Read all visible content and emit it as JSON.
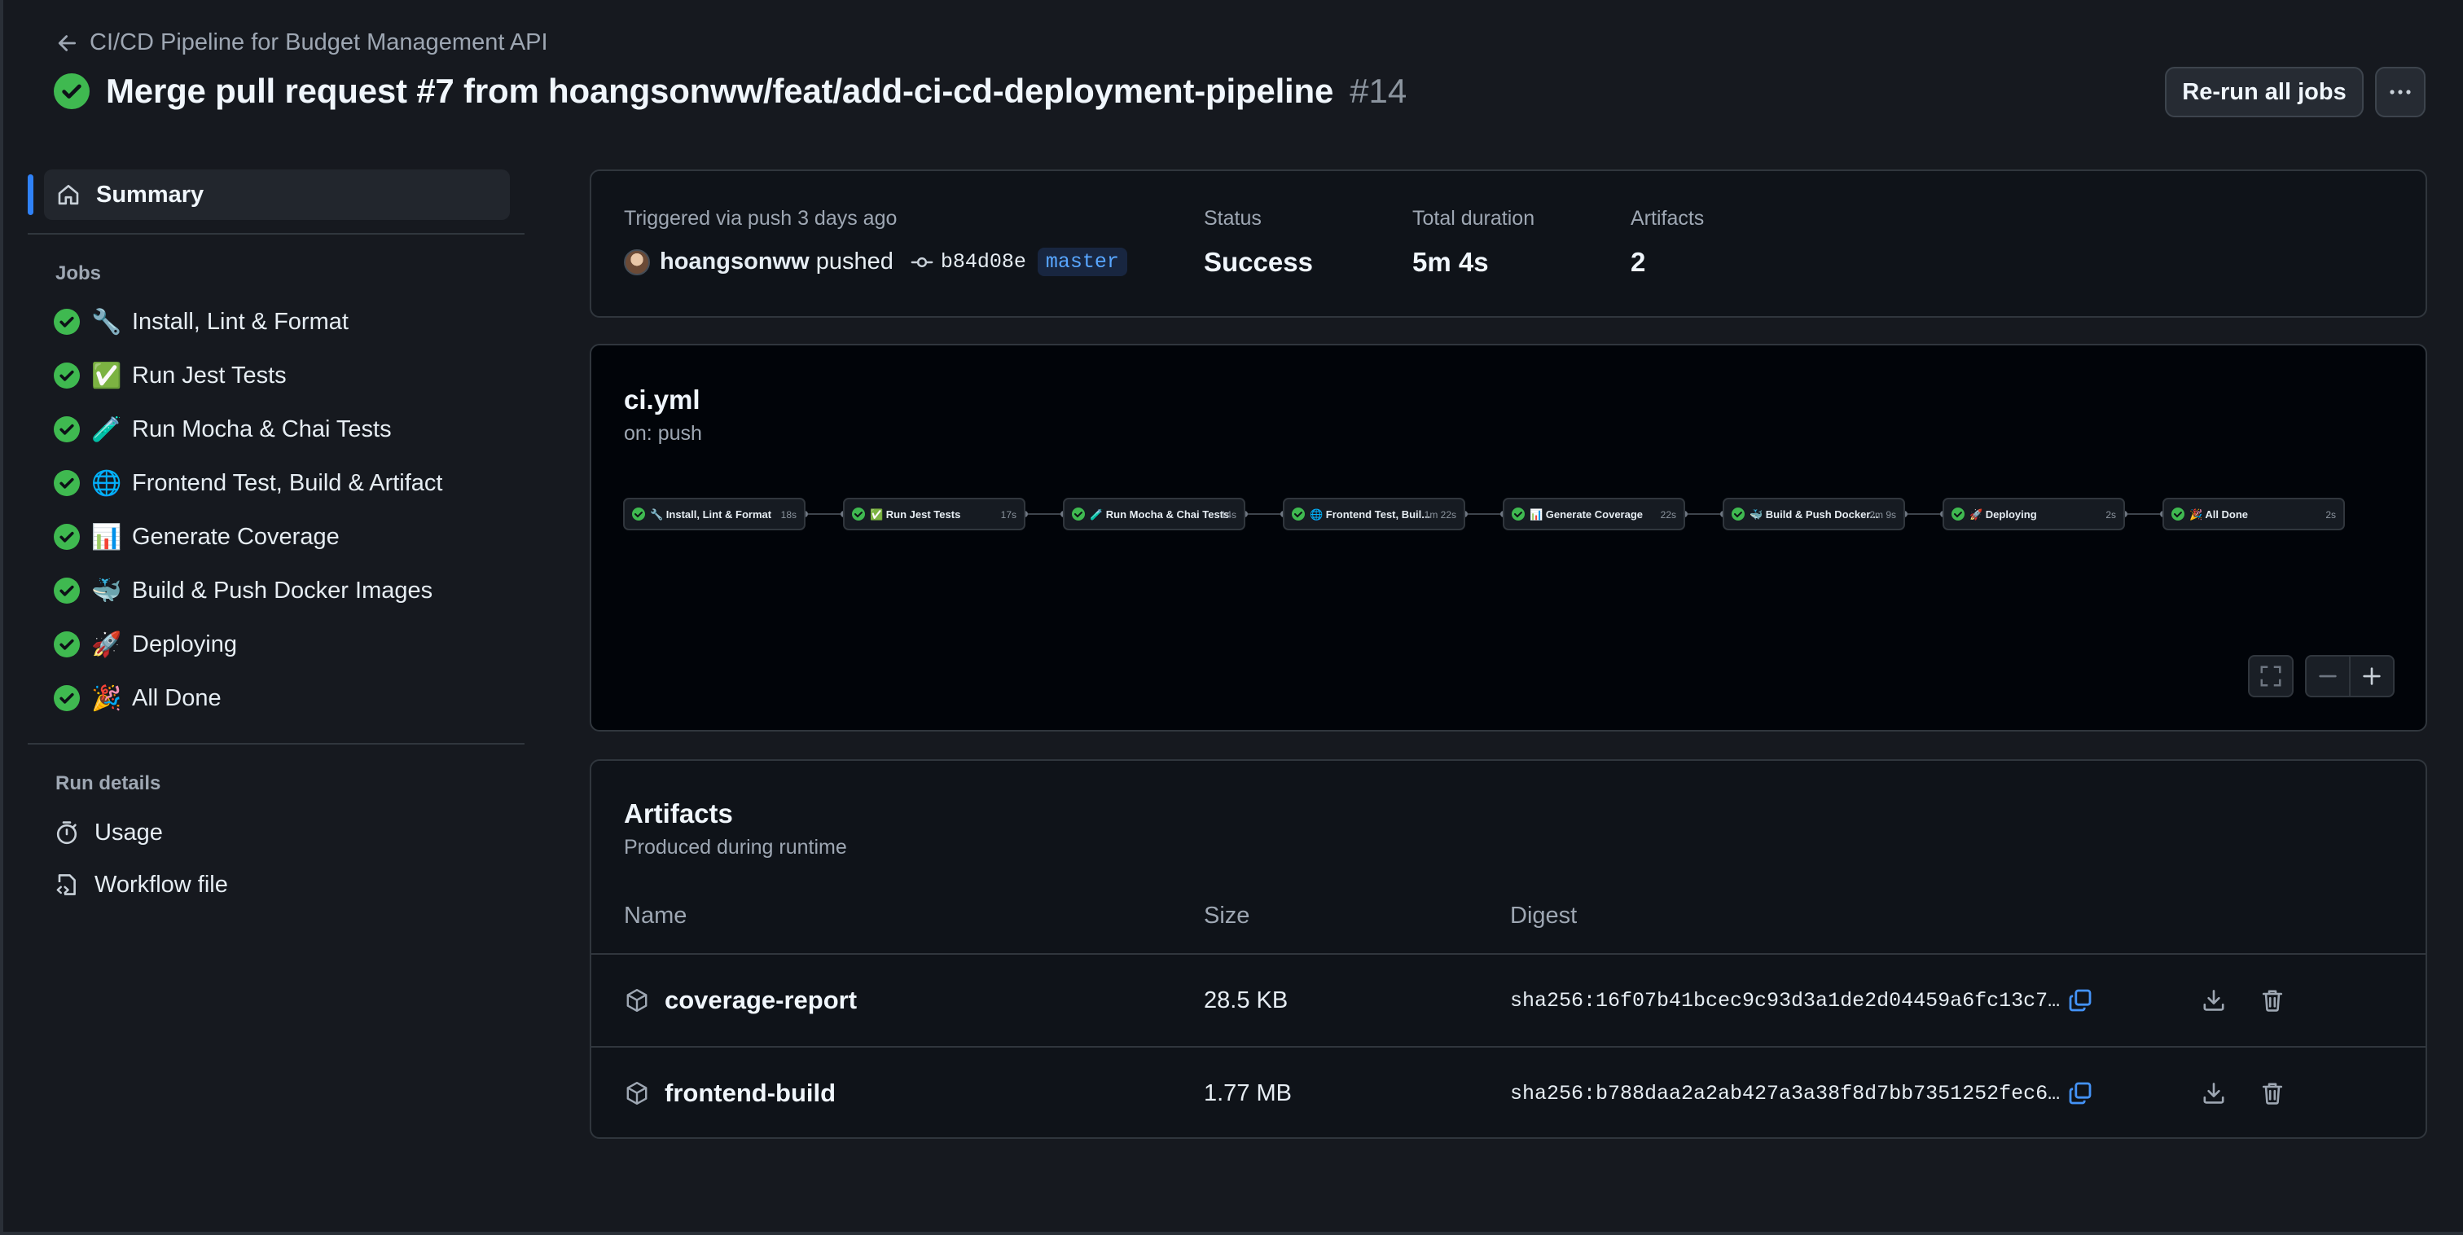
{
  "header": {
    "back_label": "CI/CD Pipeline for Budget Management API",
    "title": "Merge pull request #7 from hoangsonww/feat/add-ci-cd-deployment-pipeline",
    "run_number": "#14",
    "rerun_label": "Re-run all jobs"
  },
  "sidebar": {
    "summary_label": "Summary",
    "jobs_heading": "Jobs",
    "jobs": [
      {
        "emoji": "🔧",
        "label": "Install, Lint & Format"
      },
      {
        "emoji": "✅",
        "label": "Run Jest Tests"
      },
      {
        "emoji": "🧪",
        "label": "Run Mocha & Chai Tests"
      },
      {
        "emoji": "🌐",
        "label": "Frontend Test, Build & Artifact"
      },
      {
        "emoji": "📊",
        "label": "Generate Coverage"
      },
      {
        "emoji": "🐳",
        "label": "Build & Push Docker Images"
      },
      {
        "emoji": "🚀",
        "label": "Deploying"
      },
      {
        "emoji": "🎉",
        "label": "All Done"
      }
    ],
    "run_details_heading": "Run details",
    "usage_label": "Usage",
    "workflow_file_label": "Workflow file"
  },
  "summary": {
    "triggered": "Triggered via push 3 days ago",
    "actor": "hoangsonww",
    "action": "pushed",
    "commit": "b84d08e",
    "branch": "master",
    "status_label": "Status",
    "status_value": "Success",
    "duration_label": "Total duration",
    "duration_value": "5m 4s",
    "artifacts_label": "Artifacts",
    "artifacts_value": "2"
  },
  "workflow": {
    "file": "ci.yml",
    "trigger": "on: push",
    "nodes": [
      {
        "label": "🔧 Install, Lint & Format",
        "time": "18s"
      },
      {
        "label": "✅ Run Jest Tests",
        "time": "17s"
      },
      {
        "label": "🧪 Run Mocha & Chai Tests",
        "time": "14s"
      },
      {
        "label": "🌐 Frontend Test, Buil...",
        "time": "1m 22s"
      },
      {
        "label": "📊 Generate Coverage",
        "time": "22s"
      },
      {
        "label": "🐳 Build & Push Docker...",
        "time": "2m 9s"
      },
      {
        "label": "🚀 Deploying",
        "time": "2s"
      },
      {
        "label": "🎉 All Done",
        "time": "2s"
      }
    ]
  },
  "artifacts": {
    "title": "Artifacts",
    "subtitle": "Produced during runtime",
    "columns": {
      "name": "Name",
      "size": "Size",
      "digest": "Digest"
    },
    "rows": [
      {
        "name": "coverage-report",
        "size": "28.5 KB",
        "digest": "sha256:16f07b41bcec9c93d3a1de2d04459a6fc13c7…"
      },
      {
        "name": "frontend-build",
        "size": "1.77 MB",
        "digest": "sha256:b788daa2a2ab427a3a38f8d7bb7351252fec6…"
      }
    ]
  },
  "colors": {
    "success": "#3fb950",
    "accent": "#2f81f7",
    "link": "#58a6ff"
  },
  "icons": [
    "arrow-left-icon",
    "check-circle-icon",
    "kebab-horizontal-icon",
    "home-icon",
    "stopwatch-icon",
    "workflow-file-icon",
    "git-commit-icon",
    "package-icon",
    "copy-icon",
    "download-icon",
    "trash-icon",
    "fullscreen-icon",
    "zoom-out-icon",
    "zoom-in-icon"
  ]
}
